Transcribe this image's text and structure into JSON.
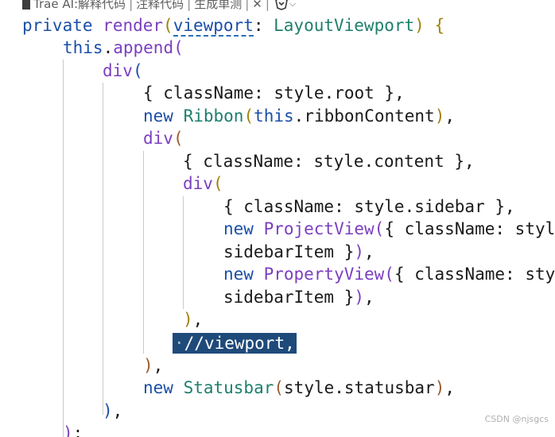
{
  "codelens": {
    "explain": "Trae AI:解释代码",
    "comment": "注释代码",
    "tests": "生成单测",
    "close": "✕",
    "separator": "|"
  },
  "code": {
    "l1": {
      "kw": "private",
      "fn": "render",
      "p_open": "(",
      "param": "viewport",
      "colon": ": ",
      "type": "LayoutViewport",
      "p_close": ")",
      "brace": " {"
    },
    "l2": {
      "this": "this",
      "dot": ".",
      "fn": "append",
      "p": "("
    },
    "l3": {
      "fn": "div",
      "p": "("
    },
    "l4": {
      "text": "{ className: style.root },"
    },
    "l5": {
      "kw": "new ",
      "cls": "Ribbon",
      "p_open": "(",
      "kw2": "this",
      "rest": ".ribbonContent",
      "p_close": ")",
      "tail": ","
    },
    "l6": {
      "fn": "div",
      "p": "("
    },
    "l7": {
      "text": "{ className: style.content },"
    },
    "l8": {
      "fn": "div",
      "p": "("
    },
    "l9": {
      "text": "{ className: style.sidebar },"
    },
    "l10": {
      "kw": "new ",
      "cls": "ProjectView",
      "p": "(",
      "rest": "{ className: styl"
    },
    "l11": {
      "text": "sidebarItem }",
      "p": ")",
      "tail": ","
    },
    "l12": {
      "kw": "new ",
      "cls": "PropertyView",
      "p": "(",
      "rest": "{ className: sty"
    },
    "l13": {
      "text": "sidebarItem }",
      "p": ")",
      "tail": ","
    },
    "l14": {
      "p": ")",
      "tail": ","
    },
    "l15": {
      "dot": "·",
      "text": "//viewport,"
    },
    "l16": {
      "p": ")",
      "tail": ","
    },
    "l17": {
      "kw": "new ",
      "cls": "Statusbar",
      "p_open": "(",
      "rest": "style.statusbar",
      "p_close": ")",
      "tail": ","
    },
    "l18": {
      "p": ")",
      "tail": ","
    },
    "l19": {
      "p": ")",
      "tail": ";"
    }
  },
  "watermark": "CSDN @njsgcs",
  "colors": {
    "keyword": "#1b4fa8",
    "function": "#7b3fbf",
    "class": "#1e7f6c",
    "selection": "#1e4a7a"
  }
}
